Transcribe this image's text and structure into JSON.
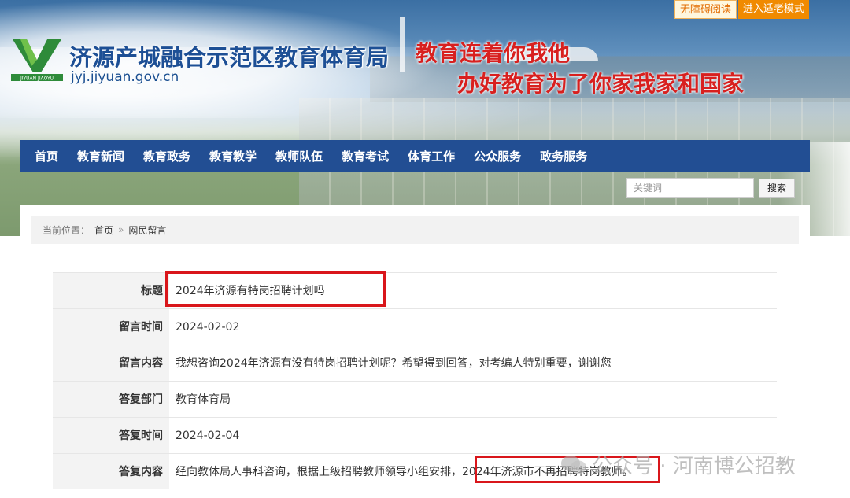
{
  "header": {
    "top_buttons": {
      "accessibility": "无障碍阅读",
      "elder_mode": "进入适老模式"
    },
    "site_title": "济源产城融合示范区教育体育局",
    "site_domain": "jyj.jiyuan.gov.cn",
    "logo_text": "JIYUAN JIAOYU",
    "slogan_line1": "教育连着你我他",
    "slogan_line2": "办好教育为了你家我家和国家"
  },
  "nav": {
    "items": [
      "首页",
      "教育新闻",
      "教育政务",
      "教育教学",
      "教师队伍",
      "教育考试",
      "体育工作",
      "公众服务",
      "政务服务"
    ]
  },
  "search": {
    "placeholder": "关键词",
    "button": "搜索"
  },
  "breadcrumb": {
    "prefix": "当前位置：",
    "home": "首页",
    "separator": "»",
    "current": "网民留言"
  },
  "detail": {
    "rows": [
      {
        "label": "标题",
        "value": "2024年济源有特岗招聘计划吗"
      },
      {
        "label": "留言时间",
        "value": "2024-02-02"
      },
      {
        "label": "留言内容",
        "value": "我想咨询2024年济源有没有特岗招聘计划呢？希望得到回答，对考编人特别重要，谢谢您"
      },
      {
        "label": "答复部门",
        "value": "教育体育局"
      },
      {
        "label": "答复时间",
        "value": "2024-02-04"
      },
      {
        "label": "答复内容",
        "value": "经向教体局人事科咨询，根据上级招聘教师领导小组安排，2024年济源市不再招聘特岗教师。"
      }
    ]
  },
  "watermark": "公众号 · 河南博公招教",
  "colors": {
    "nav_bg": "#224e93",
    "title_blue": "#1d4f95",
    "slogan_red": "#d8201f",
    "highlight_red": "#d9161b",
    "elder_orange": "#f08a00"
  }
}
